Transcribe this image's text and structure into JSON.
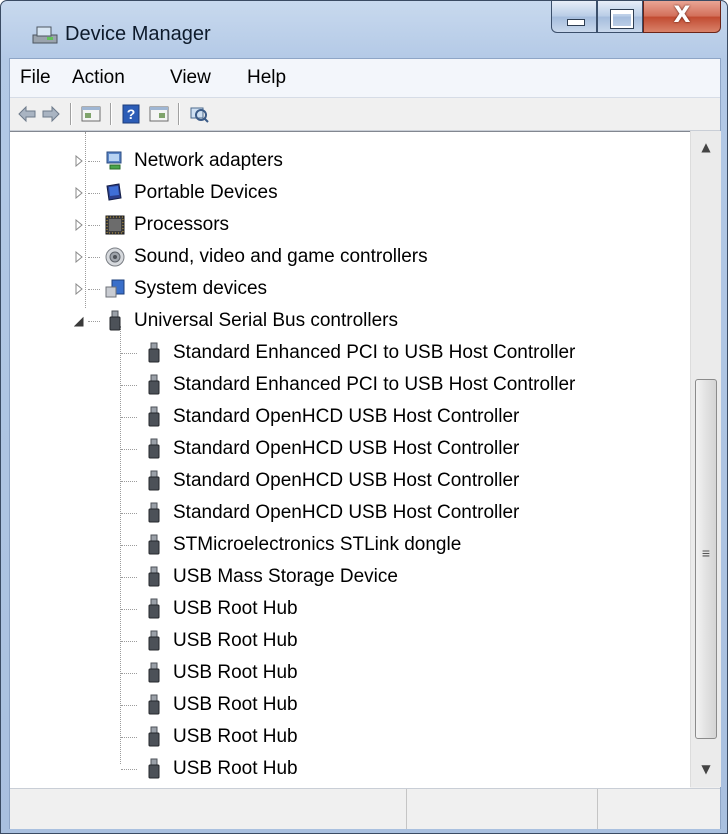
{
  "window": {
    "title": "Device Manager"
  },
  "caption_buttons": {
    "minimize_glyph": "_",
    "maximize_glyph": "☐",
    "close_glyph": "X"
  },
  "menu": [
    "File",
    "Action",
    "View",
    "Help"
  ],
  "toolbar": [
    "back-arrow-icon",
    "forward-arrow-icon",
    "properties-panel-icon",
    "help-icon",
    "console-tree-icon",
    "scan-hardware-icon"
  ],
  "tree": {
    "categories": [
      {
        "label": "Network adapters",
        "icon": "network-adapter-icon",
        "expanded": false
      },
      {
        "label": "Portable Devices",
        "icon": "portable-device-icon",
        "expanded": false
      },
      {
        "label": "Processors",
        "icon": "processor-icon",
        "expanded": false
      },
      {
        "label": "Sound, video and game controllers",
        "icon": "speaker-icon",
        "expanded": false
      },
      {
        "label": "System devices",
        "icon": "system-device-icon",
        "expanded": false
      },
      {
        "label": "Universal Serial Bus controllers",
        "icon": "usb-plug-icon",
        "expanded": true
      }
    ],
    "usb_children": [
      "Standard Enhanced PCI to USB Host Controller",
      "Standard Enhanced PCI to USB Host Controller",
      "Standard OpenHCD USB Host Controller",
      "Standard OpenHCD USB Host Controller",
      "Standard OpenHCD USB Host Controller",
      "Standard OpenHCD USB Host Controller",
      "STMicroelectronics STLink dongle",
      "USB Mass Storage Device",
      "USB Root Hub",
      "USB Root Hub",
      "USB Root Hub",
      "USB Root Hub",
      "USB Root Hub",
      "USB Root Hub"
    ]
  },
  "scrollbar": {
    "up_glyph": "▲",
    "down_glyph": "▼",
    "grip_glyph": "≡"
  },
  "colors": {
    "title_bar": "#b3c9e6",
    "close_button": "#c14a30",
    "tree_background": "#ffffff"
  }
}
